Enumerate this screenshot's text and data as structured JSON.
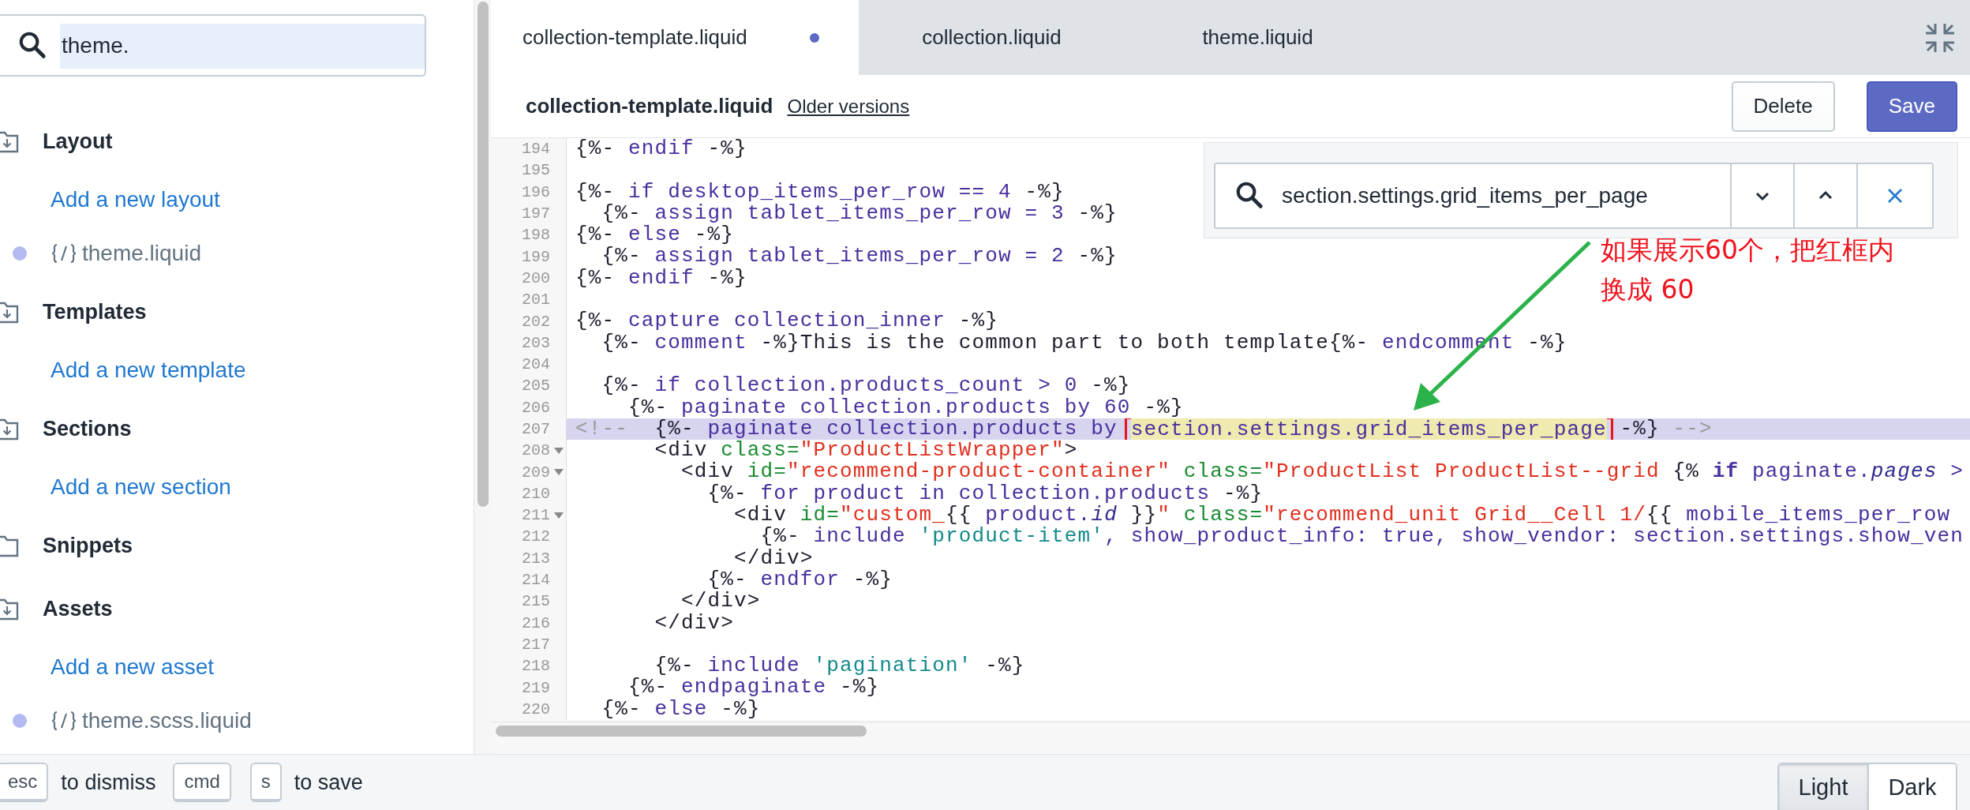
{
  "sidebar": {
    "search": {
      "value": "theme.",
      "value_selected": true
    },
    "sections": [
      {
        "title": "Layout",
        "expanded": true,
        "entries": [
          {
            "kind": "link",
            "label": "Add a new layout"
          },
          {
            "kind": "file",
            "label": "theme.liquid",
            "modified": true
          }
        ]
      },
      {
        "title": "Templates",
        "expanded": true,
        "entries": [
          {
            "kind": "link",
            "label": "Add a new template"
          }
        ]
      },
      {
        "title": "Sections",
        "expanded": true,
        "entries": [
          {
            "kind": "link",
            "label": "Add a new section"
          }
        ]
      },
      {
        "title": "Snippets",
        "expanded": false
      },
      {
        "title": "Assets",
        "expanded": true,
        "entries": [
          {
            "kind": "link",
            "label": "Add a new asset"
          },
          {
            "kind": "file",
            "label": "theme.scss.liquid",
            "modified": true
          }
        ]
      }
    ]
  },
  "tabs": [
    {
      "label": "collection-template.liquid",
      "selected": true,
      "modified": true
    },
    {
      "label": "collection.liquid",
      "selected": false,
      "modified": false
    },
    {
      "label": "theme.liquid",
      "selected": false,
      "modified": false
    }
  ],
  "header": {
    "title": "collection-template.liquid",
    "link": "Older versions",
    "buttons": [
      {
        "label": "Delete",
        "kind": "secondary"
      },
      {
        "label": "Save",
        "kind": "primary"
      }
    ]
  },
  "find": {
    "value": "section.settings.grid_items_per_page"
  },
  "code": {
    "lines": [
      {
        "number": "194",
        "foldable": false,
        "highlighted": false,
        "tokens": [
          {
            "kind": "plain",
            "text": "{%-"
          },
          {
            "kind": "liquid",
            "text": " endif "
          },
          {
            "kind": "plain",
            "text": "-%}"
          }
        ]
      },
      {
        "number": "195",
        "foldable": false,
        "highlighted": false
      },
      {
        "number": "196",
        "foldable": false,
        "highlighted": false,
        "tokens": [
          {
            "kind": "plain",
            "text": "{%-"
          },
          {
            "kind": "liquid",
            "text": " if desktop_items_per_row == 4 "
          },
          {
            "kind": "plain",
            "text": "-%}"
          }
        ]
      },
      {
        "number": "197",
        "foldable": false,
        "highlighted": false,
        "tokens": [
          {
            "kind": "plain",
            "text": "  {%-"
          },
          {
            "kind": "liquid",
            "text": " assign tablet_items_per_row = 3 "
          },
          {
            "kind": "plain",
            "text": "-%}"
          }
        ]
      },
      {
        "number": "198",
        "foldable": false,
        "highlighted": false,
        "tokens": [
          {
            "kind": "plain",
            "text": "{%-"
          },
          {
            "kind": "liquid",
            "text": " else "
          },
          {
            "kind": "plain",
            "text": "-%}"
          }
        ]
      },
      {
        "number": "199",
        "foldable": false,
        "highlighted": false,
        "tokens": [
          {
            "kind": "plain",
            "text": "  {%-"
          },
          {
            "kind": "liquid",
            "text": " assign tablet_items_per_row = 2 "
          },
          {
            "kind": "plain",
            "text": "-%}"
          }
        ]
      },
      {
        "number": "200",
        "foldable": false,
        "highlighted": false,
        "tokens": [
          {
            "kind": "plain",
            "text": "{%-"
          },
          {
            "kind": "liquid",
            "text": " endif "
          },
          {
            "kind": "plain",
            "text": "-%}"
          }
        ]
      },
      {
        "number": "201",
        "foldable": false,
        "highlighted": false
      },
      {
        "number": "202",
        "foldable": false,
        "highlighted": false,
        "tokens": [
          {
            "kind": "plain",
            "text": "{%-"
          },
          {
            "kind": "liquid",
            "text": " capture collection_inner "
          },
          {
            "kind": "plain",
            "text": "-%}"
          }
        ]
      },
      {
        "number": "203",
        "foldable": false,
        "highlighted": false,
        "tokens": [
          {
            "kind": "plain",
            "text": "  {%-"
          },
          {
            "kind": "liquid",
            "text": " comment "
          },
          {
            "kind": "plain",
            "text": "-%}This is the common part to both template{%-"
          },
          {
            "kind": "liquid",
            "text": " endcomment "
          },
          {
            "kind": "plain",
            "text": "-%}"
          }
        ]
      },
      {
        "number": "204",
        "foldable": false,
        "highlighted": false
      },
      {
        "number": "205",
        "foldable": false,
        "highlighted": false,
        "tokens": [
          {
            "kind": "plain",
            "text": "  {%-"
          },
          {
            "kind": "liquid",
            "text": " if collection.products_count > 0 "
          },
          {
            "kind": "plain",
            "text": "-%}"
          }
        ]
      },
      {
        "number": "206",
        "foldable": false,
        "highlighted": false,
        "tokens": [
          {
            "kind": "plain",
            "text": "    {%-"
          },
          {
            "kind": "liquid",
            "text": " paginate collection.products by 60 "
          },
          {
            "kind": "plain",
            "text": "-%}"
          }
        ]
      },
      {
        "number": "207",
        "foldable": false,
        "highlighted": true,
        "tokens": [
          {
            "kind": "comment",
            "text": "<!--  "
          },
          {
            "kind": "plain",
            "text": "{%-"
          },
          {
            "kind": "liquid",
            "text": " paginate collection.products by "
          },
          {
            "kind": "match",
            "text": "section.settings.grid_items_per_page",
            "boxed": true
          },
          {
            "kind": "plain",
            "text": " -%}"
          },
          {
            "kind": "comment",
            "text": " -->"
          }
        ]
      },
      {
        "number": "208",
        "foldable": true,
        "highlighted": false,
        "tokens": [
          {
            "kind": "plain",
            "text": "      <div "
          },
          {
            "kind": "attribute",
            "text": "class="
          },
          {
            "kind": "string",
            "text": "\"ProductListWrapper\""
          },
          {
            "kind": "plain",
            "text": ">"
          }
        ]
      },
      {
        "number": "209",
        "foldable": true,
        "highlighted": false,
        "tokens": [
          {
            "kind": "plain",
            "text": "        <div "
          },
          {
            "kind": "attribute",
            "text": "id="
          },
          {
            "kind": "string",
            "text": "\"recommend-product-container\""
          },
          {
            "kind": "attribute",
            "text": " class="
          },
          {
            "kind": "string",
            "text": "\"ProductList ProductList--grid "
          },
          {
            "kind": "plain",
            "text": "{%"
          },
          {
            "kind": "bold",
            "text": " if"
          },
          {
            "kind": "liquid",
            "text": " paginate."
          },
          {
            "kind": "italic",
            "text": "pages"
          },
          {
            "kind": "liquid",
            "text": " >"
          }
        ]
      },
      {
        "number": "210",
        "foldable": false,
        "highlighted": false,
        "tokens": [
          {
            "kind": "plain",
            "text": "          {%-"
          },
          {
            "kind": "liquid",
            "text": " for product in collection.products "
          },
          {
            "kind": "plain",
            "text": "-%}"
          }
        ]
      },
      {
        "number": "211",
        "foldable": true,
        "highlighted": false,
        "tokens": [
          {
            "kind": "plain",
            "text": "            <div "
          },
          {
            "kind": "attribute",
            "text": "id="
          },
          {
            "kind": "string",
            "text": "\"custom_"
          },
          {
            "kind": "plain",
            "text": "{{"
          },
          {
            "kind": "liquid",
            "text": " product."
          },
          {
            "kind": "italic",
            "text": "id"
          },
          {
            "kind": "plain",
            "text": " }}"
          },
          {
            "kind": "string",
            "text": "\""
          },
          {
            "kind": "attribute",
            "text": " class="
          },
          {
            "kind": "string",
            "text": "\"recommend_unit Grid__Cell 1/"
          },
          {
            "kind": "plain",
            "text": "{{"
          },
          {
            "kind": "liquid",
            "text": " mobile_items_per_row"
          }
        ]
      },
      {
        "number": "212",
        "foldable": false,
        "highlighted": false,
        "tokens": [
          {
            "kind": "plain",
            "text": "              {%-"
          },
          {
            "kind": "liquid",
            "text": " include "
          },
          {
            "kind": "literal",
            "text": "'product-item'"
          },
          {
            "kind": "liquid",
            "text": ", show_product_info: true, show_vendor: section.settings.show_ven"
          }
        ]
      },
      {
        "number": "213",
        "foldable": false,
        "highlighted": false,
        "tokens": [
          {
            "kind": "plain",
            "text": "            </div>"
          }
        ]
      },
      {
        "number": "214",
        "foldable": false,
        "highlighted": false,
        "tokens": [
          {
            "kind": "plain",
            "text": "          {%-"
          },
          {
            "kind": "liquid",
            "text": " endfor "
          },
          {
            "kind": "plain",
            "text": "-%}"
          }
        ]
      },
      {
        "number": "215",
        "foldable": false,
        "highlighted": false,
        "tokens": [
          {
            "kind": "plain",
            "text": "        </div>"
          }
        ]
      },
      {
        "number": "216",
        "foldable": false,
        "highlighted": false,
        "tokens": [
          {
            "kind": "plain",
            "text": "      </div>"
          }
        ]
      },
      {
        "number": "217",
        "foldable": false,
        "highlighted": false
      },
      {
        "number": "218",
        "foldable": false,
        "highlighted": false,
        "tokens": [
          {
            "kind": "plain",
            "text": "      {%-"
          },
          {
            "kind": "liquid",
            "text": " include "
          },
          {
            "kind": "literal",
            "text": "'pagination'"
          },
          {
            "kind": "plain",
            "text": " -%}"
          }
        ]
      },
      {
        "number": "219",
        "foldable": false,
        "highlighted": false,
        "tokens": [
          {
            "kind": "plain",
            "text": "    {%-"
          },
          {
            "kind": "liquid",
            "text": " endpaginate "
          },
          {
            "kind": "plain",
            "text": "-%}"
          }
        ]
      },
      {
        "number": "220",
        "foldable": false,
        "highlighted": false,
        "tokens": [
          {
            "kind": "plain",
            "text": "  {%-"
          },
          {
            "kind": "liquid",
            "text": " else "
          },
          {
            "kind": "plain",
            "text": "-%}"
          }
        ]
      }
    ]
  },
  "annotation": {
    "lines": [
      "如果展示60个，把红框内",
      "换成 60"
    ]
  },
  "footer": {
    "hints": [
      {
        "key": "esc",
        "text": "to dismiss"
      },
      {
        "key": "cmd"
      },
      {
        "key": "s",
        "text": "to save"
      }
    ],
    "themes": [
      {
        "label": "Light",
        "selected": true
      },
      {
        "label": "Dark",
        "selected": false
      }
    ]
  }
}
